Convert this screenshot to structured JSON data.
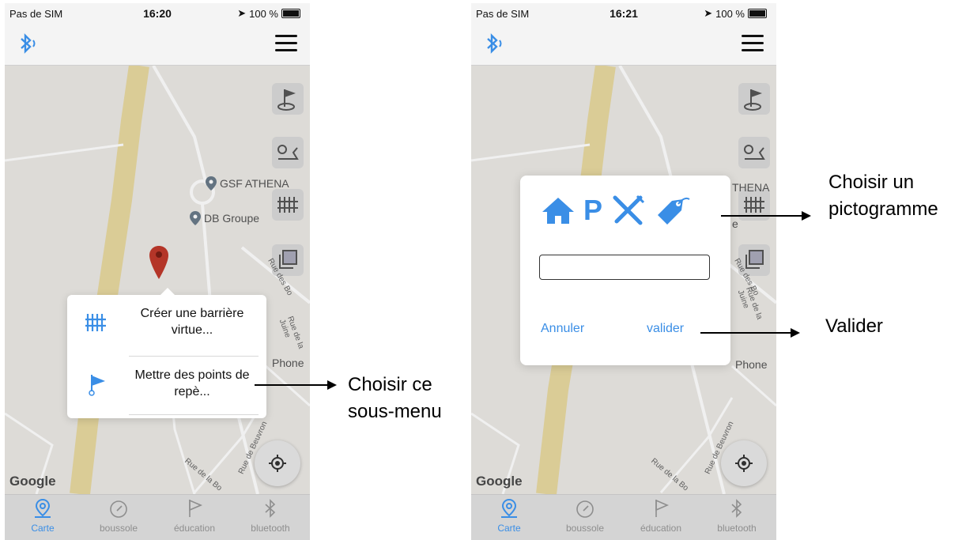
{
  "colors": {
    "accent": "#3a8ee6",
    "road": "#e8d9a0",
    "marker": "#c0392b",
    "annotation": "#000000"
  },
  "screens": [
    {
      "status": {
        "carrier": "Pas de SIM",
        "time": "16:20",
        "battery": "100 %"
      },
      "pois": [
        "GSF ATHENA",
        "DB Groupe"
      ],
      "streets": [
        "Rue des Bo",
        "Rue de la Juine",
        "Rue de Beuvron",
        "Rue de la Bo"
      ],
      "other_label": "Phone",
      "google": "Google",
      "menu_items": [
        {
          "icon": "barrier-icon",
          "label": "Créer une barrière virtue..."
        },
        {
          "icon": "flag-icon",
          "label": "Mettre des points de repè..."
        }
      ],
      "tabs": [
        {
          "icon": "map-pin-icon",
          "label": "Carte"
        },
        {
          "icon": "compass-icon",
          "label": "boussole"
        },
        {
          "icon": "flag-icon",
          "label": "éducation"
        },
        {
          "icon": "bluetooth-icon",
          "label": "bluetooth"
        }
      ]
    },
    {
      "status": {
        "carrier": "Pas de SIM",
        "time": "16:21",
        "battery": "100 %"
      },
      "pois": [
        "THENA",
        "e"
      ],
      "streets": [
        "Rue des Bo",
        "Rue de la Juine",
        "Rue de Beuvron",
        "Rue de la Bo"
      ],
      "other_label": "Phone",
      "google": "Google",
      "dialog": {
        "pictograms": [
          "home-icon",
          "parking-icon",
          "restaurant-icon",
          "tag-icon"
        ],
        "parking_letter": "P",
        "input_value": "",
        "cancel": "Annuler",
        "confirm": "valider"
      },
      "tabs": [
        {
          "icon": "map-pin-icon",
          "label": "Carte"
        },
        {
          "icon": "compass-icon",
          "label": "boussole"
        },
        {
          "icon": "flag-icon",
          "label": "éducation"
        },
        {
          "icon": "bluetooth-icon",
          "label": "bluetooth"
        }
      ]
    }
  ],
  "annotations": {
    "submenu": [
      "Choisir ce",
      "sous-menu"
    ],
    "pictogram": [
      "Choisir un",
      "pictogramme"
    ],
    "validate": "Valider"
  }
}
